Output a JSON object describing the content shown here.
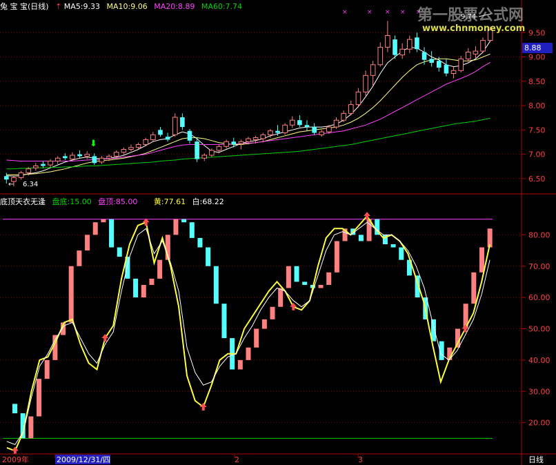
{
  "colors": {
    "background": "#000000",
    "axis": "#b40000",
    "up": "#ff8080",
    "down": "#54ffff",
    "ma5": "#ffffff",
    "ma10": "#ffff80",
    "ma20": "#ff40ff",
    "ma60": "#00d200",
    "yellow_line": "#ffff40",
    "white_line": "#ffffff",
    "top_line": "#ff40ff",
    "bottom_line": "#00d200",
    "label_magenta": "#ff40ff",
    "label_green": "#00d200",
    "axis_text": "#ff4040",
    "date_highlight_bg": "#2020c0",
    "price_tag_bg": "#2020c0"
  },
  "header": {
    "name": "兔 宝 宝(日线)",
    "ma5_label": "MA5:9.33",
    "ma10_label": "MA10:9.06",
    "ma20_label": "MA20:8.89",
    "ma60_label": "MA60:7.74"
  },
  "indicator_header": {
    "name": "底顶天衣无逢",
    "bottom_label": "盘底:15.00",
    "top_label": "盘顶:85.00",
    "yellow_label": "黄:77.61",
    "white_label": "白:68.22"
  },
  "price_annotations": {
    "high_label": "9.74",
    "low_label": "6.34",
    "current_price_tag": "8.88"
  },
  "x_axis_labels": [
    "2009年",
    "2009/12/31/四",
    "2",
    "3"
  ],
  "period_button": "日线",
  "watermark": {
    "line1": "第一股票公式网",
    "line2": "www.chnmoney.com"
  },
  "chart_data": [
    {
      "type": "candlestick",
      "ylim": [
        6.2,
        10.0
      ],
      "y_ticks": [
        "6.50",
        "7.00",
        "7.50",
        "8.00",
        "8.50",
        "9.00",
        "9.50"
      ],
      "candles": [
        {
          "o": 6.55,
          "h": 6.62,
          "l": 6.4,
          "c": 6.48
        },
        {
          "o": 6.44,
          "h": 6.56,
          "l": 6.34,
          "c": 6.52
        },
        {
          "o": 6.52,
          "h": 6.66,
          "l": 6.48,
          "c": 6.62
        },
        {
          "o": 6.62,
          "h": 6.74,
          "l": 6.56,
          "c": 6.7
        },
        {
          "o": 6.72,
          "h": 6.82,
          "l": 6.66,
          "c": 6.76
        },
        {
          "o": 6.8,
          "h": 6.86,
          "l": 6.72,
          "c": 6.76
        },
        {
          "o": 6.78,
          "h": 6.9,
          "l": 6.74,
          "c": 6.86
        },
        {
          "o": 6.86,
          "h": 6.96,
          "l": 6.8,
          "c": 6.92
        },
        {
          "o": 6.96,
          "h": 7.02,
          "l": 6.88,
          "c": 6.92
        },
        {
          "o": 6.9,
          "h": 7.04,
          "l": 6.86,
          "c": 6.98
        },
        {
          "o": 7.0,
          "h": 7.08,
          "l": 6.92,
          "c": 6.96
        },
        {
          "o": 6.96,
          "h": 7.06,
          "l": 6.9,
          "c": 7.0
        },
        {
          "o": 6.96,
          "h": 7.02,
          "l": 6.78,
          "c": 6.82
        },
        {
          "o": 6.84,
          "h": 6.96,
          "l": 6.8,
          "c": 6.92
        },
        {
          "o": 6.92,
          "h": 7.0,
          "l": 6.86,
          "c": 6.96
        },
        {
          "o": 6.96,
          "h": 7.08,
          "l": 6.92,
          "c": 7.04
        },
        {
          "o": 7.04,
          "h": 7.14,
          "l": 7.0,
          "c": 7.1
        },
        {
          "o": 7.1,
          "h": 7.2,
          "l": 7.06,
          "c": 7.14
        },
        {
          "o": 7.14,
          "h": 7.24,
          "l": 7.1,
          "c": 7.2
        },
        {
          "o": 7.2,
          "h": 7.34,
          "l": 7.16,
          "c": 7.3
        },
        {
          "o": 7.3,
          "h": 7.46,
          "l": 7.26,
          "c": 7.4
        },
        {
          "o": 7.5,
          "h": 7.56,
          "l": 7.36,
          "c": 7.4
        },
        {
          "o": 7.36,
          "h": 7.44,
          "l": 7.26,
          "c": 7.3
        },
        {
          "o": 7.4,
          "h": 7.84,
          "l": 7.36,
          "c": 7.76
        },
        {
          "o": 7.76,
          "h": 7.84,
          "l": 7.5,
          "c": 7.56
        },
        {
          "o": 7.48,
          "h": 7.52,
          "l": 7.22,
          "c": 7.28
        },
        {
          "o": 7.26,
          "h": 7.34,
          "l": 6.84,
          "c": 6.9
        },
        {
          "o": 6.92,
          "h": 7.02,
          "l": 6.86,
          "c": 6.98
        },
        {
          "o": 6.98,
          "h": 7.12,
          "l": 6.94,
          "c": 7.08
        },
        {
          "o": 7.08,
          "h": 7.2,
          "l": 7.02,
          "c": 7.16
        },
        {
          "o": 7.16,
          "h": 7.3,
          "l": 7.12,
          "c": 7.26
        },
        {
          "o": 7.26,
          "h": 7.34,
          "l": 7.14,
          "c": 7.2
        },
        {
          "o": 7.22,
          "h": 7.3,
          "l": 7.1,
          "c": 7.26
        },
        {
          "o": 7.26,
          "h": 7.36,
          "l": 7.2,
          "c": 7.32
        },
        {
          "o": 7.3,
          "h": 7.38,
          "l": 7.22,
          "c": 7.34
        },
        {
          "o": 7.32,
          "h": 7.44,
          "l": 7.24,
          "c": 7.4
        },
        {
          "o": 7.4,
          "h": 7.52,
          "l": 7.34,
          "c": 7.48
        },
        {
          "o": 7.48,
          "h": 7.6,
          "l": 7.38,
          "c": 7.44
        },
        {
          "o": 7.44,
          "h": 7.64,
          "l": 7.4,
          "c": 7.6
        },
        {
          "o": 7.6,
          "h": 7.78,
          "l": 7.54,
          "c": 7.7
        },
        {
          "o": 7.7,
          "h": 7.8,
          "l": 7.56,
          "c": 7.6
        },
        {
          "o": 7.6,
          "h": 7.7,
          "l": 7.48,
          "c": 7.56
        },
        {
          "o": 7.56,
          "h": 7.64,
          "l": 7.4,
          "c": 7.44
        },
        {
          "o": 7.4,
          "h": 7.5,
          "l": 7.36,
          "c": 7.46
        },
        {
          "o": 7.46,
          "h": 7.6,
          "l": 7.42,
          "c": 7.56
        },
        {
          "o": 7.56,
          "h": 7.76,
          "l": 7.52,
          "c": 7.7
        },
        {
          "o": 7.7,
          "h": 7.9,
          "l": 7.66,
          "c": 7.84
        },
        {
          "o": 7.84,
          "h": 8.1,
          "l": 7.8,
          "c": 8.02
        },
        {
          "o": 8.02,
          "h": 8.36,
          "l": 7.96,
          "c": 8.28
        },
        {
          "o": 8.28,
          "h": 8.72,
          "l": 8.2,
          "c": 8.62
        },
        {
          "o": 8.62,
          "h": 8.92,
          "l": 8.4,
          "c": 8.84
        },
        {
          "o": 8.84,
          "h": 9.3,
          "l": 8.8,
          "c": 9.2
        },
        {
          "o": 9.2,
          "h": 9.74,
          "l": 9.1,
          "c": 9.44
        },
        {
          "o": 9.36,
          "h": 9.44,
          "l": 8.96,
          "c": 9.04
        },
        {
          "o": 9.04,
          "h": 9.28,
          "l": 8.96,
          "c": 9.16
        },
        {
          "o": 9.16,
          "h": 9.44,
          "l": 9.08,
          "c": 9.36
        },
        {
          "o": 9.4,
          "h": 9.5,
          "l": 9.1,
          "c": 9.16
        },
        {
          "o": 9.1,
          "h": 9.2,
          "l": 8.84,
          "c": 8.94
        },
        {
          "o": 8.96,
          "h": 9.12,
          "l": 8.8,
          "c": 8.88
        },
        {
          "o": 8.92,
          "h": 9.0,
          "l": 8.7,
          "c": 8.78
        },
        {
          "o": 8.84,
          "h": 8.96,
          "l": 8.6,
          "c": 8.66
        },
        {
          "o": 8.66,
          "h": 8.8,
          "l": 8.56,
          "c": 8.72
        },
        {
          "o": 8.72,
          "h": 9.02,
          "l": 8.68,
          "c": 8.96
        },
        {
          "o": 8.96,
          "h": 9.18,
          "l": 8.9,
          "c": 9.1
        },
        {
          "o": 9.06,
          "h": 9.22,
          "l": 8.98,
          "c": 9.12
        },
        {
          "o": 9.12,
          "h": 9.4,
          "l": 9.08,
          "c": 9.34
        },
        {
          "o": 9.34,
          "h": 9.62,
          "l": 9.3,
          "c": 9.56
        }
      ],
      "series": [
        {
          "name": "MA5",
          "values": [
            6.56,
            6.55,
            6.56,
            6.6,
            6.62,
            6.66,
            6.72,
            6.78,
            6.84,
            6.88,
            6.92,
            6.94,
            6.92,
            6.9,
            6.92,
            6.94,
            6.98,
            7.04,
            7.1,
            7.18,
            7.26,
            7.3,
            7.32,
            7.4,
            7.46,
            7.42,
            7.32,
            7.18,
            7.06,
            7.04,
            7.1,
            7.16,
            7.22,
            7.26,
            7.28,
            7.32,
            7.38,
            7.42,
            7.46,
            7.5,
            7.54,
            7.56,
            7.56,
            7.56,
            7.58,
            7.62,
            7.7,
            7.82,
            7.98,
            8.18,
            8.4,
            8.66,
            8.88,
            9.0,
            9.12,
            9.2,
            9.18,
            9.1,
            9.0,
            8.94,
            8.84,
            8.8,
            8.82,
            8.88,
            8.96,
            9.1,
            9.33
          ]
        },
        {
          "name": "MA10",
          "values": [
            6.58,
            6.58,
            6.58,
            6.59,
            6.6,
            6.62,
            6.64,
            6.67,
            6.7,
            6.74,
            6.78,
            6.82,
            6.85,
            6.87,
            6.88,
            6.9,
            6.92,
            6.95,
            6.98,
            7.02,
            7.08,
            7.14,
            7.2,
            7.26,
            7.32,
            7.34,
            7.34,
            7.32,
            7.28,
            7.24,
            7.22,
            7.2,
            7.2,
            7.22,
            7.24,
            7.26,
            7.3,
            7.34,
            7.38,
            7.42,
            7.46,
            7.48,
            7.5,
            7.52,
            7.54,
            7.56,
            7.6,
            7.66,
            7.74,
            7.84,
            7.96,
            8.1,
            8.26,
            8.42,
            8.58,
            8.72,
            8.84,
            8.9,
            8.94,
            8.96,
            8.96,
            8.94,
            8.92,
            8.92,
            8.94,
            9.0,
            9.06
          ]
        },
        {
          "name": "MA20",
          "values": [
            6.88,
            6.87,
            6.86,
            6.86,
            6.86,
            6.86,
            6.86,
            6.86,
            6.86,
            6.86,
            6.87,
            6.88,
            6.89,
            6.9,
            6.91,
            6.92,
            6.94,
            6.96,
            6.98,
            7.0,
            7.04,
            7.08,
            7.12,
            7.16,
            7.19,
            7.2,
            7.2,
            7.2,
            7.2,
            7.2,
            7.2,
            7.21,
            7.22,
            7.23,
            7.24,
            7.26,
            7.28,
            7.3,
            7.32,
            7.34,
            7.36,
            7.38,
            7.4,
            7.42,
            7.44,
            7.46,
            7.48,
            7.52,
            7.56,
            7.6,
            7.66,
            7.72,
            7.8,
            7.88,
            7.96,
            8.04,
            8.12,
            8.2,
            8.28,
            8.36,
            8.44,
            8.5,
            8.56,
            8.62,
            8.7,
            8.8,
            8.89
          ]
        },
        {
          "name": "MA60",
          "values": [
            6.7,
            6.7,
            6.71,
            6.71,
            6.72,
            6.72,
            6.73,
            6.73,
            6.74,
            6.74,
            6.75,
            6.76,
            6.76,
            6.77,
            6.78,
            6.79,
            6.8,
            6.81,
            6.82,
            6.83,
            6.84,
            6.86,
            6.87,
            6.88,
            6.9,
            6.91,
            6.92,
            6.93,
            6.94,
            6.95,
            6.96,
            6.97,
            6.98,
            6.99,
            7.0,
            7.01,
            7.02,
            7.03,
            7.04,
            7.05,
            7.06,
            7.08,
            7.1,
            7.12,
            7.14,
            7.16,
            7.18,
            7.2,
            7.23,
            7.26,
            7.29,
            7.32,
            7.35,
            7.38,
            7.41,
            7.44,
            7.47,
            7.5,
            7.53,
            7.56,
            7.59,
            7.62,
            7.64,
            7.66,
            7.68,
            7.71,
            7.74
          ]
        }
      ]
    },
    {
      "type": "line",
      "ylim": [
        10,
        90
      ],
      "y_ticks": [
        "20.00",
        "30.00",
        "40.00",
        "50.00",
        "60.00",
        "70.00",
        "80.00"
      ],
      "reference_lines": [
        {
          "name": "盘顶",
          "value": 85
        },
        {
          "name": "盘底",
          "value": 15
        }
      ],
      "series": [
        {
          "name": "黄",
          "values": [
            12,
            11,
            17,
            30,
            40,
            41,
            46,
            52,
            53,
            45,
            39,
            37,
            47,
            51,
            66,
            77,
            83,
            84,
            71,
            79,
            70,
            57,
            35,
            27,
            25,
            32,
            40,
            42,
            42,
            50,
            54,
            58,
            62,
            65,
            62,
            57,
            56,
            59,
            70,
            79,
            82,
            82,
            80,
            83,
            86,
            82,
            79,
            80,
            78,
            74,
            66,
            58,
            45,
            33,
            40,
            45,
            50,
            55,
            65,
            77
          ]
        },
        {
          "name": "白",
          "values": [
            14,
            13,
            17,
            28,
            38,
            42,
            47,
            51,
            52,
            47,
            42,
            39,
            45,
            49,
            62,
            73,
            80,
            82,
            74,
            78,
            71,
            62,
            44,
            36,
            32,
            33,
            38,
            41,
            42,
            47,
            51,
            56,
            60,
            63,
            62,
            59,
            57,
            59,
            67,
            75,
            80,
            81,
            80,
            82,
            84,
            82,
            80,
            80,
            78,
            75,
            70,
            63,
            52,
            42,
            40,
            43,
            48,
            53,
            61,
            72
          ]
        },
        {
          "name": "柱",
          "values": [
            26,
            23,
            15,
            22,
            34,
            40,
            48,
            52,
            70,
            75,
            80,
            84,
            85,
            76,
            73,
            66,
            60,
            64,
            66,
            72,
            80,
            85,
            84,
            79,
            76,
            70,
            58,
            47,
            37,
            40,
            44,
            50,
            53,
            57,
            63,
            70,
            65,
            64,
            63,
            64,
            68,
            78,
            82,
            80,
            78,
            85,
            80,
            77,
            76,
            72,
            67,
            60,
            53,
            46,
            40,
            44,
            50,
            58,
            68,
            76,
            82
          ]
        }
      ]
    }
  ]
}
